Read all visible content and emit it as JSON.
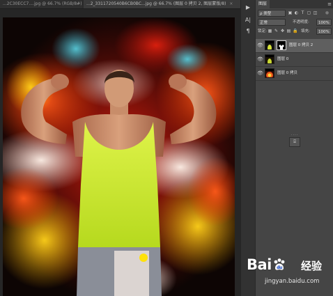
{
  "document_tabs": [
    {
      "label": "...2C30ECC7....jpg @ 66.7% (RGB/8#)"
    },
    {
      "label": "...2_3311720540B6CB0BC...jpg @ 66.7% (图层 0 拷贝 2, 图层蒙版/8)"
    }
  ],
  "tab_close_glyph": "×",
  "side_icons": [
    "play-icon",
    "text-align-icon",
    "paragraph-icon"
  ],
  "layers_panel": {
    "tab_label": "图层",
    "menu_glyph": "≡",
    "filter": {
      "kind_label": "ρ 类型"
    },
    "blend_mode": "正常",
    "opacity_label": "不透明度:",
    "opacity_value": "100%",
    "lock_label": "锁定:",
    "fill_label": "填充:",
    "fill_value": "100%",
    "layers": [
      {
        "name": "图层 0 拷贝 2",
        "selected": true,
        "has_mask": true,
        "visible": true
      },
      {
        "name": "图层 0",
        "selected": false,
        "has_mask": false,
        "visible": true
      },
      {
        "name": "图层 0 拷贝",
        "selected": false,
        "has_mask": false,
        "visible": true
      }
    ]
  },
  "watermark": {
    "brand_left": "Bai",
    "brand_right": "经验",
    "url": "jingyan.baidu.com"
  },
  "colors": {
    "accent_selected_row": "#5f5f5f",
    "panel_bg": "#454545",
    "canvas_bg": "#262626",
    "shirt_color": "#c8e832"
  }
}
